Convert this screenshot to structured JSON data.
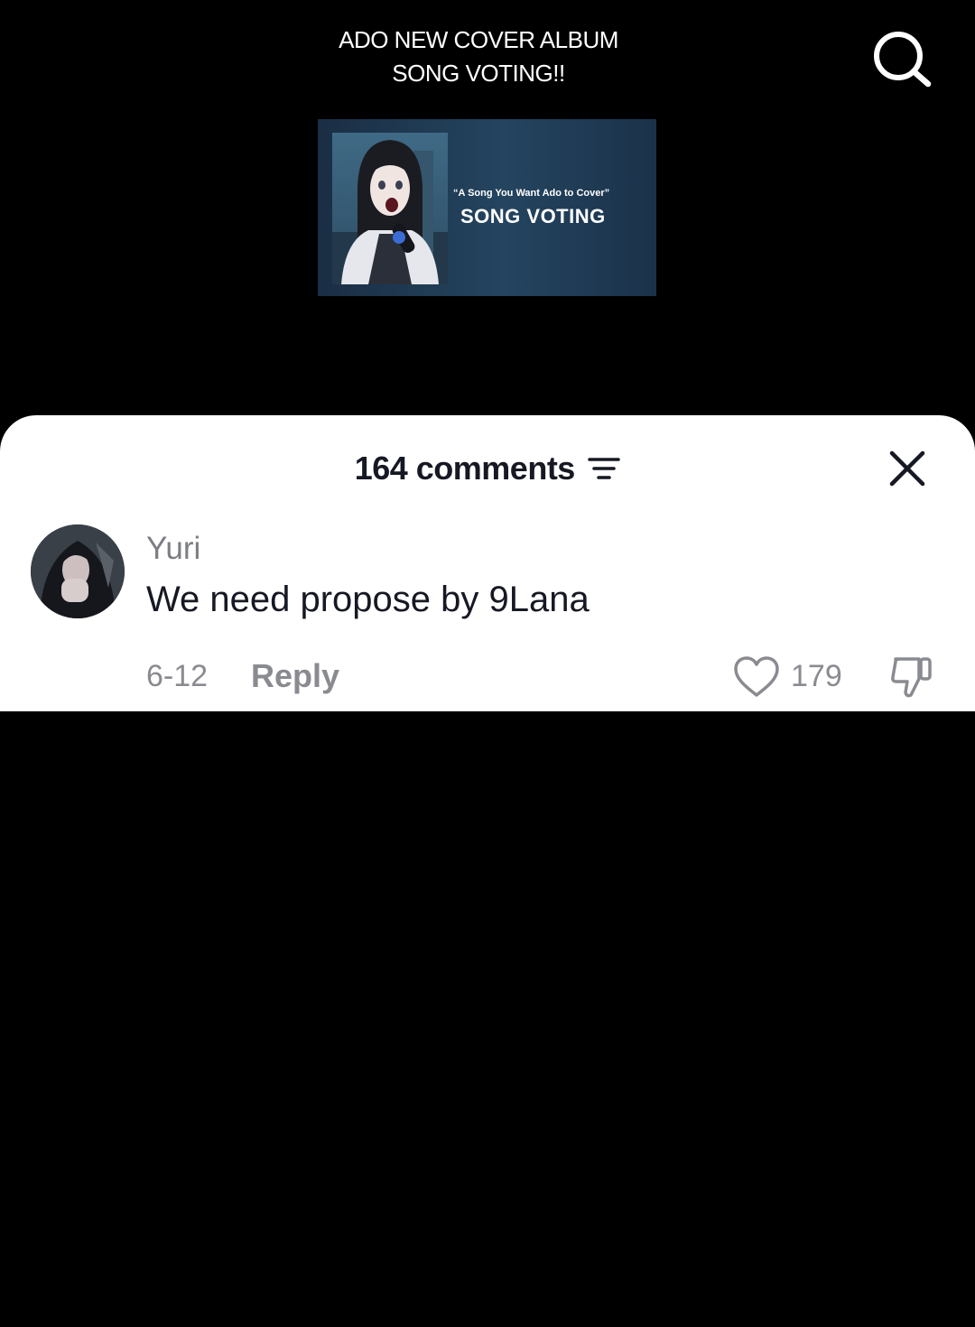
{
  "video": {
    "title_line1": "ADO NEW COVER ALBUM",
    "title_line2": "SONG VOTING!!",
    "thumbnail": {
      "subtitle": "“A Song You Want Ado to Cover”",
      "headline": "SONG VOTING"
    }
  },
  "icons": {
    "search": "search-icon",
    "sort": "sort-lines-icon",
    "close": "close-icon",
    "like": "heart-outline-icon",
    "dislike": "thumbs-down-icon"
  },
  "comments_panel": {
    "count_label": "164 comments",
    "comments": [
      {
        "username": "Yuri",
        "text": "We need propose by 9Lana",
        "date": "6-12",
        "reply_label": "Reply",
        "likes": "179"
      }
    ]
  },
  "colors": {
    "background": "#000000",
    "sheet": "#ffffff",
    "primary_text": "#161823",
    "secondary_text": "#8a8b91"
  }
}
